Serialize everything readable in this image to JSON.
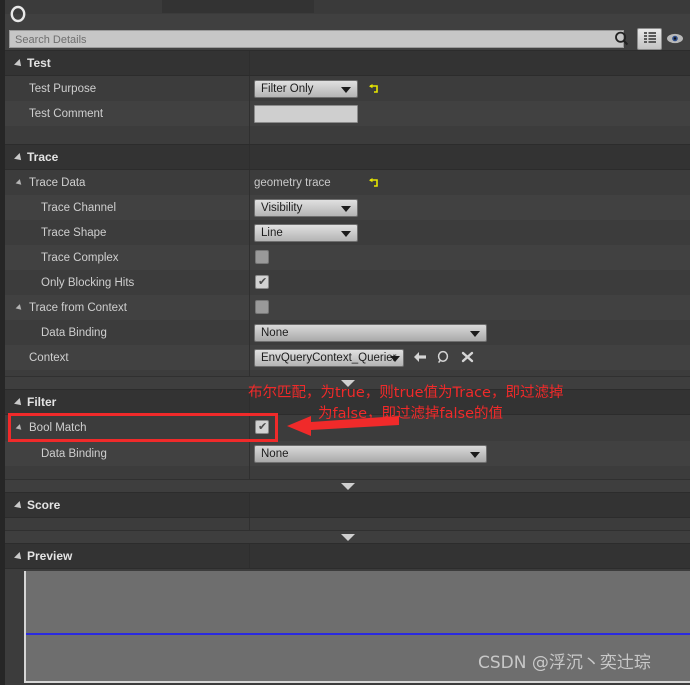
{
  "window": {
    "logo_icon": "circle-icon"
  },
  "search": {
    "placeholder": "Search Details",
    "search_icon": "magnifier-icon",
    "grid_button_icon": "grid-view-icon",
    "visibility_icon": "eye-icon"
  },
  "sections": [
    {
      "id": "test",
      "title": "Test",
      "rows": [
        {
          "label": "Test Purpose",
          "widget": "combo",
          "value": "Filter Only",
          "reset": true
        },
        {
          "label": "Test Comment",
          "widget": "text",
          "value": ""
        }
      ]
    },
    {
      "id": "trace",
      "title": "Trace",
      "rows": [
        {
          "label": "Trace Data",
          "widget": "label",
          "value": "geometry trace",
          "reset": true
        },
        {
          "label": "Trace Channel",
          "widget": "combo",
          "value": "Visibility"
        },
        {
          "label": "Trace Shape",
          "widget": "combo",
          "value": "Line"
        },
        {
          "label": "Trace Complex",
          "widget": "checkbox",
          "value": "off"
        },
        {
          "label": "Only Blocking Hits",
          "widget": "checkbox",
          "value": "on"
        },
        {
          "label": "Trace from Context",
          "widget": "checkbox",
          "value": "off"
        },
        {
          "label": "Data Binding",
          "widget": "combo",
          "value": "None"
        },
        {
          "label": "Context",
          "widget": "combo_actions",
          "value": "EnvQueryContext_Querier"
        }
      ]
    },
    {
      "id": "filter",
      "title": "Filter",
      "rows": [
        {
          "label": "Bool Match",
          "widget": "checkbox",
          "value": "on"
        },
        {
          "label": "Data Binding",
          "widget": "combo",
          "value": "None"
        }
      ]
    },
    {
      "id": "score",
      "title": "Score",
      "rows": []
    },
    {
      "id": "preview",
      "title": "Preview",
      "rows": []
    }
  ],
  "context_actions": {
    "back_icon": "left-arrow-icon",
    "browse_icon": "magnifier-icon",
    "clear_icon": "close-x-icon"
  },
  "annotation": {
    "line1": "布尔匹配，为true，则true值为Trace，即过滤掉",
    "line2": "为false，即过滤掉false的值",
    "color": "#f02a2a",
    "target": "Bool Match"
  },
  "watermark": {
    "text": "CSDN @浮沉丶奕辻琮"
  },
  "colors": {
    "panel_bg": "#383838",
    "section_bg": "#333333",
    "row_bg": "#3c3c3c",
    "row_bg_alt": "#414141",
    "accent_red": "#f02a2a",
    "preview_line_blue": "#2a2ae0",
    "reset_yellow": "#e6e600"
  }
}
